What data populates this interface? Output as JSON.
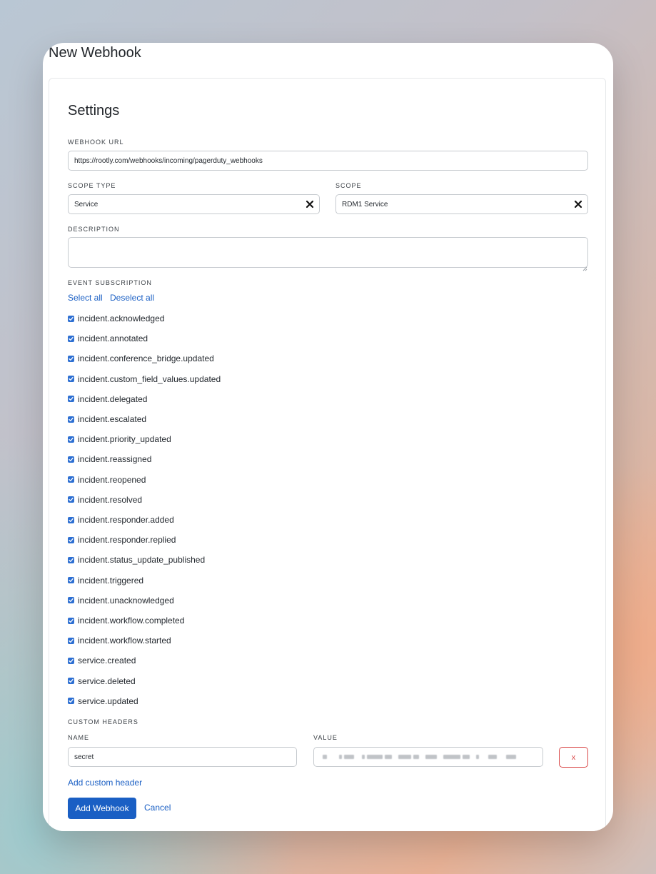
{
  "page": {
    "title": "New Webhook"
  },
  "settings": {
    "title": "Settings",
    "webhook_url": {
      "label": "WEBHOOK URL",
      "value": "https://rootly.com/webhooks/incoming/pagerduty_webhooks"
    },
    "scope_type": {
      "label": "SCOPE TYPE",
      "value": "Service"
    },
    "scope": {
      "label": "SCOPE",
      "value": "RDM1 Service"
    },
    "description": {
      "label": "DESCRIPTION",
      "value": ""
    }
  },
  "events": {
    "label": "EVENT SUBSCRIPTION",
    "select_all": "Select all",
    "deselect_all": "Deselect all",
    "items": [
      {
        "label": "incident.acknowledged",
        "checked": true
      },
      {
        "label": "incident.annotated",
        "checked": true
      },
      {
        "label": "incident.conference_bridge.updated",
        "checked": true
      },
      {
        "label": "incident.custom_field_values.updated",
        "checked": true
      },
      {
        "label": "incident.delegated",
        "checked": true
      },
      {
        "label": "incident.escalated",
        "checked": true
      },
      {
        "label": "incident.priority_updated",
        "checked": true
      },
      {
        "label": "incident.reassigned",
        "checked": true
      },
      {
        "label": "incident.reopened",
        "checked": true
      },
      {
        "label": "incident.resolved",
        "checked": true
      },
      {
        "label": "incident.responder.added",
        "checked": true
      },
      {
        "label": "incident.responder.replied",
        "checked": true
      },
      {
        "label": "incident.status_update_published",
        "checked": true
      },
      {
        "label": "incident.triggered",
        "checked": true
      },
      {
        "label": "incident.unacknowledged",
        "checked": true
      },
      {
        "label": "incident.workflow.completed",
        "checked": true
      },
      {
        "label": "incident.workflow.started",
        "checked": true
      },
      {
        "label": "service.created",
        "checked": true
      },
      {
        "label": "service.deleted",
        "checked": true
      },
      {
        "label": "service.updated",
        "checked": true
      }
    ]
  },
  "custom_headers": {
    "label": "CUSTOM HEADERS",
    "name_label": "NAME",
    "value_label": "VALUE",
    "rows": [
      {
        "name": "secret",
        "remove": "x"
      }
    ],
    "add_link": "Add custom header"
  },
  "actions": {
    "submit": "Add Webhook",
    "cancel": "Cancel"
  },
  "colors": {
    "primary": "#1a5fc4",
    "danger": "#d94848",
    "checkbox": "#2d6fd2"
  },
  "icons": {
    "clear": "close-icon",
    "check": "checkmark-icon",
    "resize": "resize-handle-icon"
  }
}
